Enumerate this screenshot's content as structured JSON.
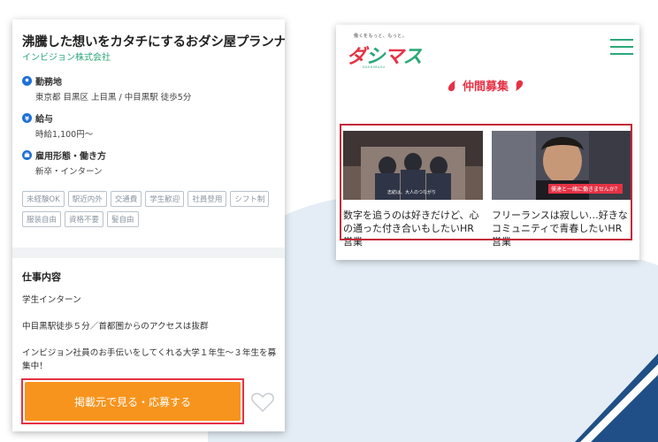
{
  "job": {
    "title": "沸騰した想いをカタチにするおダシ屋プランナー",
    "company": "インビジョン株式会社",
    "location": {
      "label": "勤務地",
      "value": "東京都 目黒区 上目黒 / 中目黒駅 徒歩5分"
    },
    "salary": {
      "label": "給与",
      "value": "時給1,100円〜"
    },
    "employment": {
      "label": "雇用形態・働き方",
      "value": "新卒・インターン"
    },
    "tags": [
      "未経験OK",
      "駅近内外",
      "交通費",
      "学生歓迎",
      "社員登用",
      "シフト制",
      "服装自由",
      "資格不要",
      "髪自由"
    ],
    "section_title": "仕事内容",
    "para1": "学生インターン",
    "para2": "中目黒駅徒歩５分／首都圏からのアクセスは抜群",
    "para3": "インビジョン社員のお手伝いをしてくれる大学１年生〜３年生を募集中！",
    "apply_label": "掲載元で見る・応募する",
    "colors": {
      "accent": "#f7941d",
      "highlight": "#e53245",
      "company": "#2aa879"
    }
  },
  "media": {
    "brand_tagline": "働くをもっと、もっと。",
    "logo_text": "ダシマス",
    "logo_sub": "DASHIMASU",
    "recruit_label": "仲間募集",
    "articles": [
      {
        "title": "数字を追うのは好きだけど、心の通った付き合いもしたいHR営業",
        "thumb_caption": "志紡は、大人のつながり"
      },
      {
        "title": "フリーランスは寂しい…好きなコミュニティで青春したいHR営業",
        "thumb_caption": "僕達と一緒に働きませんか？"
      }
    ]
  }
}
